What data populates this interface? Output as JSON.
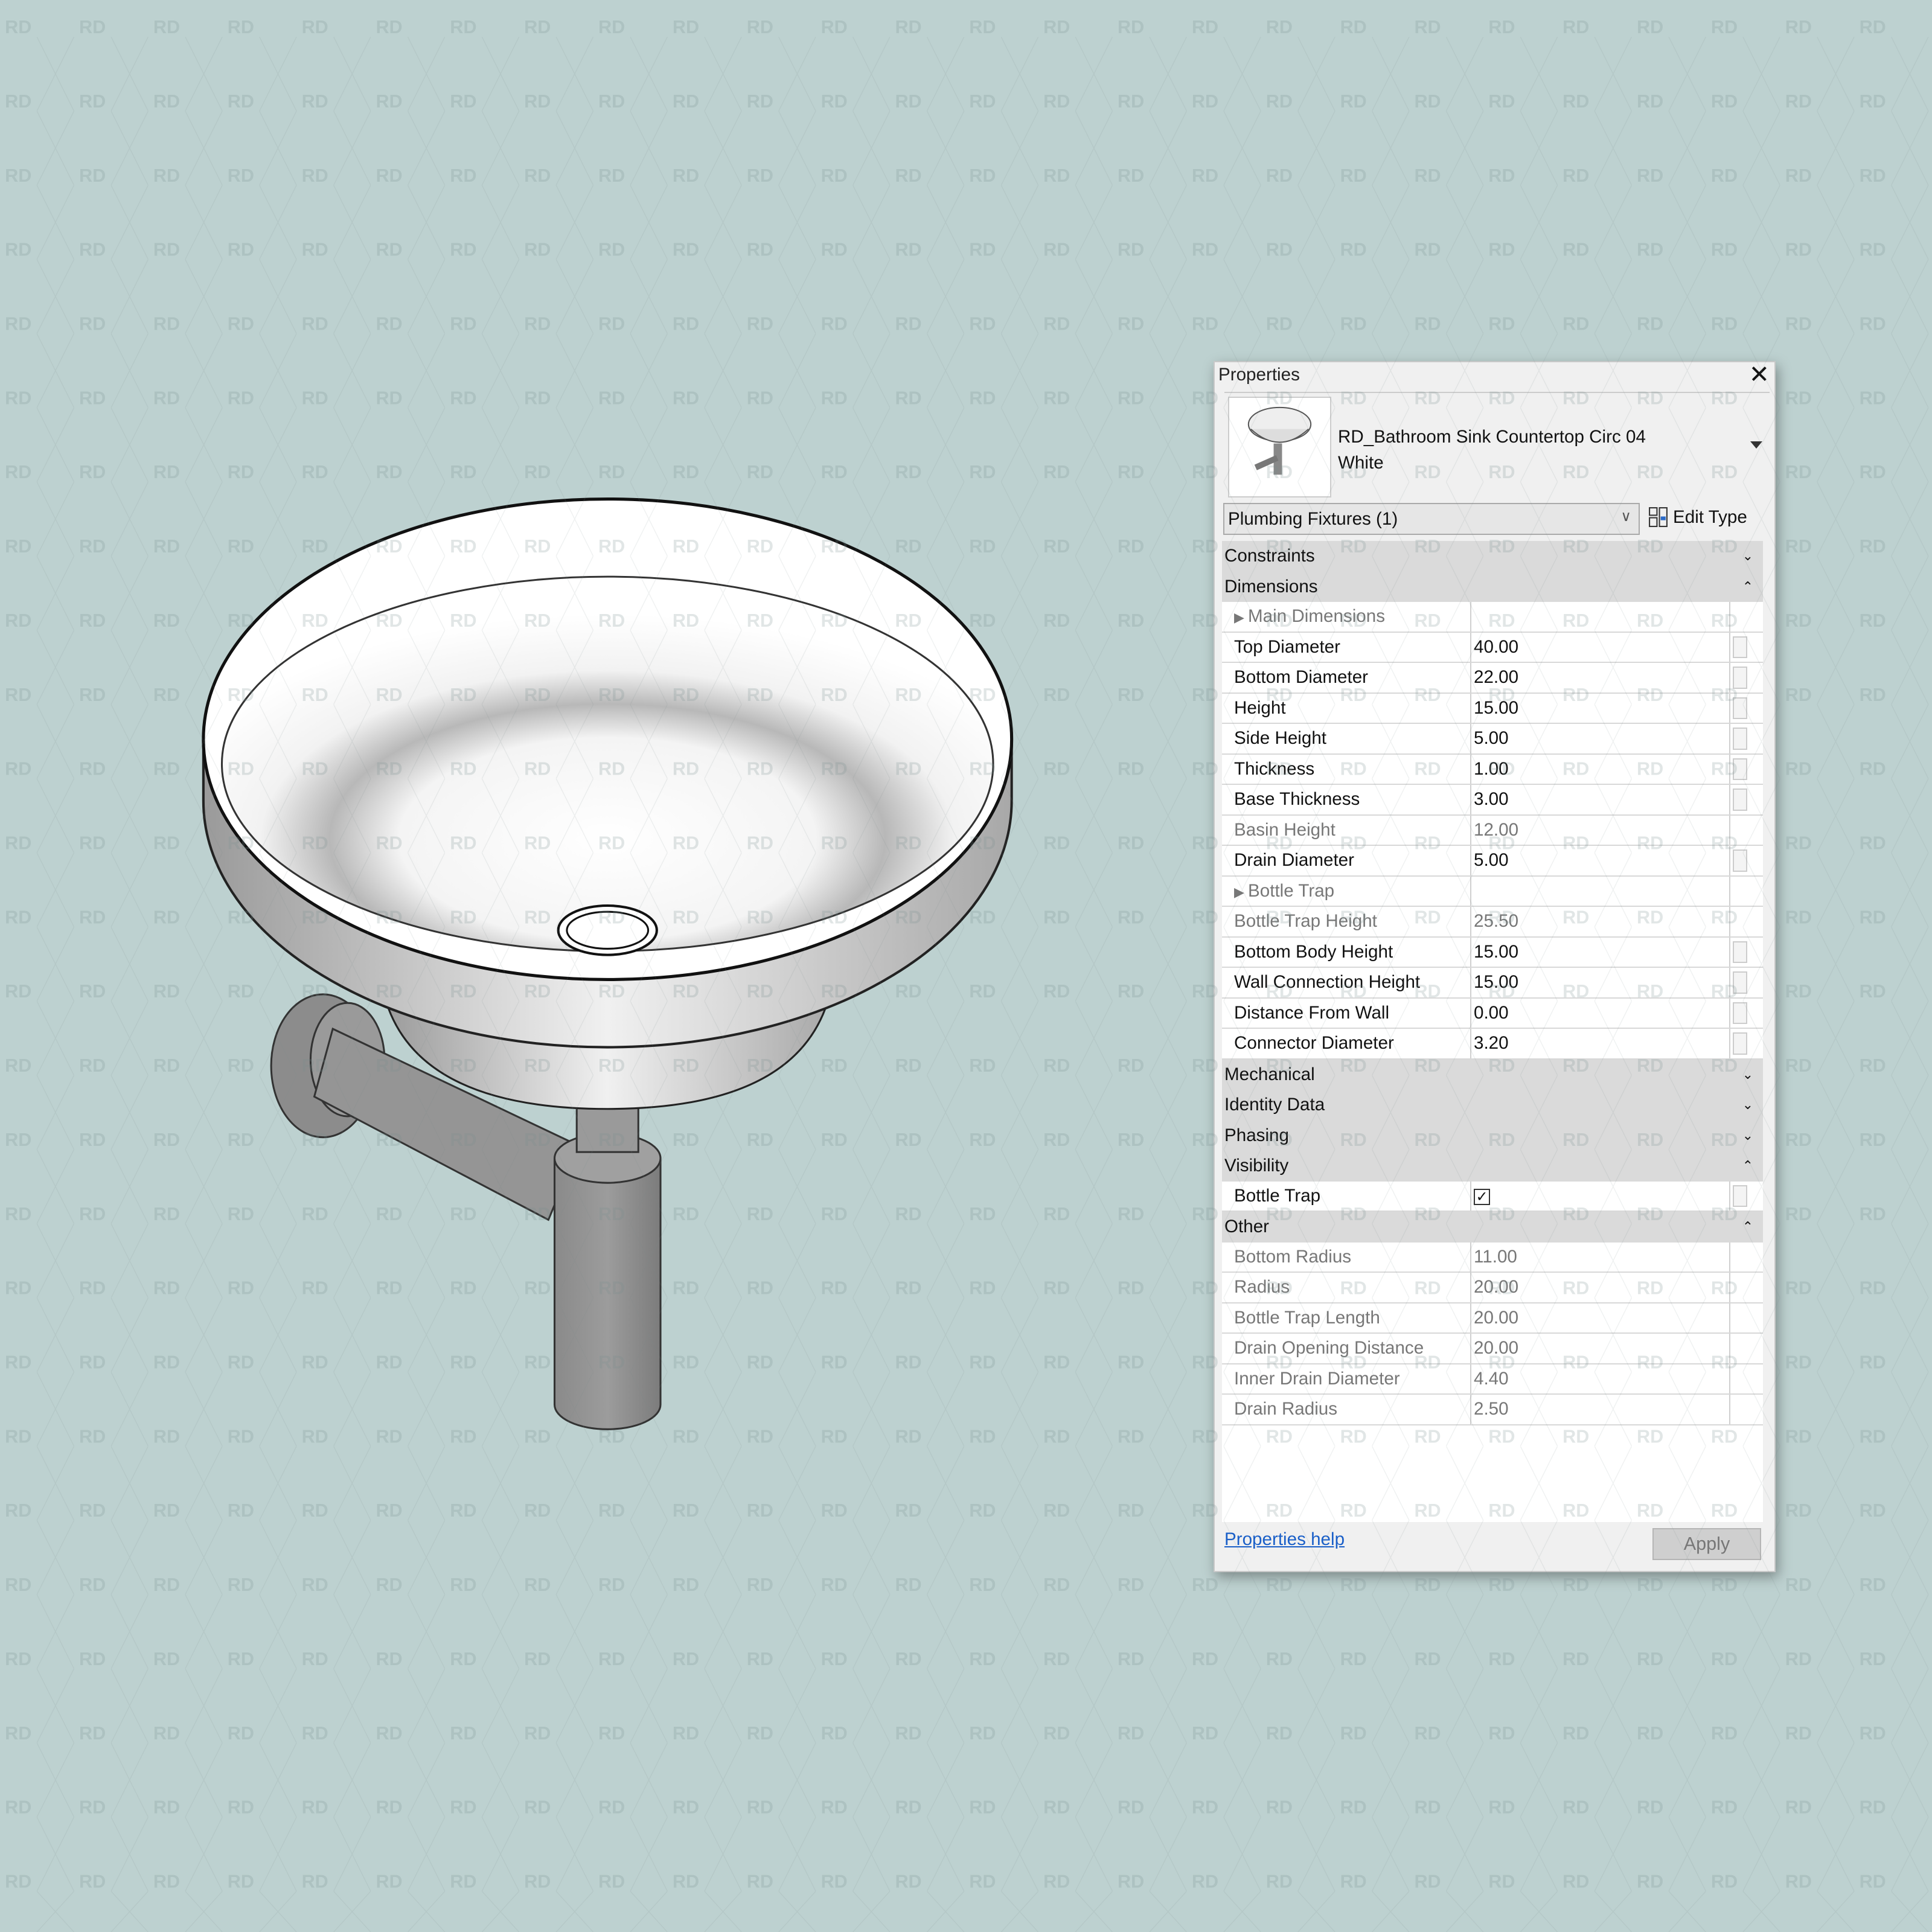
{
  "watermark": "RD",
  "properties": {
    "title": "Properties",
    "close_icon": "close-icon",
    "type_name_line1": "RD_Bathroom Sink Countertop Circ 04",
    "type_name_line2": "White",
    "category": "Plumbing Fixtures (1)",
    "edit_type": "Edit Type",
    "help_link": "Properties help",
    "apply": "Apply",
    "sections": [
      {
        "label": "Constraints",
        "expanded": false,
        "rows": []
      },
      {
        "label": "Dimensions",
        "expanded": true,
        "rows": [
          {
            "label": "Main Dimensions",
            "group": true,
            "value": ""
          },
          {
            "label": "Top Diameter",
            "value": "40.00"
          },
          {
            "label": "Bottom Diameter",
            "value": "22.00"
          },
          {
            "label": "Height",
            "value": "15.00"
          },
          {
            "label": "Side Height",
            "value": "5.00"
          },
          {
            "label": "Thickness",
            "value": "1.00"
          },
          {
            "label": "Base Thickness",
            "value": "3.00"
          },
          {
            "label": "Basin Height",
            "value": "12.00",
            "readonly": true
          },
          {
            "label": "Drain Diameter",
            "value": "5.00"
          },
          {
            "label": "Bottle Trap",
            "group": true,
            "value": ""
          },
          {
            "label": "Bottle Trap Height",
            "value": "25.50",
            "readonly": true
          },
          {
            "label": "Bottom Body Height",
            "value": "15.00"
          },
          {
            "label": "Wall Connection Height",
            "value": "15.00"
          },
          {
            "label": "Distance From Wall",
            "value": "0.00"
          },
          {
            "label": "Connector Diameter",
            "value": "3.20"
          }
        ]
      },
      {
        "label": "Mechanical",
        "expanded": false,
        "rows": []
      },
      {
        "label": "Identity Data",
        "expanded": false,
        "rows": []
      },
      {
        "label": "Phasing",
        "expanded": false,
        "rows": []
      },
      {
        "label": "Visibility",
        "expanded": true,
        "rows": [
          {
            "label": "Bottle Trap",
            "checkbox": true,
            "checked": true
          }
        ]
      },
      {
        "label": "Other",
        "expanded": true,
        "rows": [
          {
            "label": "Bottom Radius",
            "value": "11.00",
            "readonly": true
          },
          {
            "label": "Radius",
            "value": "20.00",
            "readonly": true
          },
          {
            "label": "Bottle Trap Length",
            "value": "20.00",
            "readonly": true
          },
          {
            "label": "Drain Opening Distance",
            "value": "20.00",
            "readonly": true
          },
          {
            "label": "Inner Drain Diameter",
            "value": "4.40",
            "readonly": true
          },
          {
            "label": "Drain Radius",
            "value": "2.50",
            "readonly": true
          }
        ]
      }
    ]
  }
}
